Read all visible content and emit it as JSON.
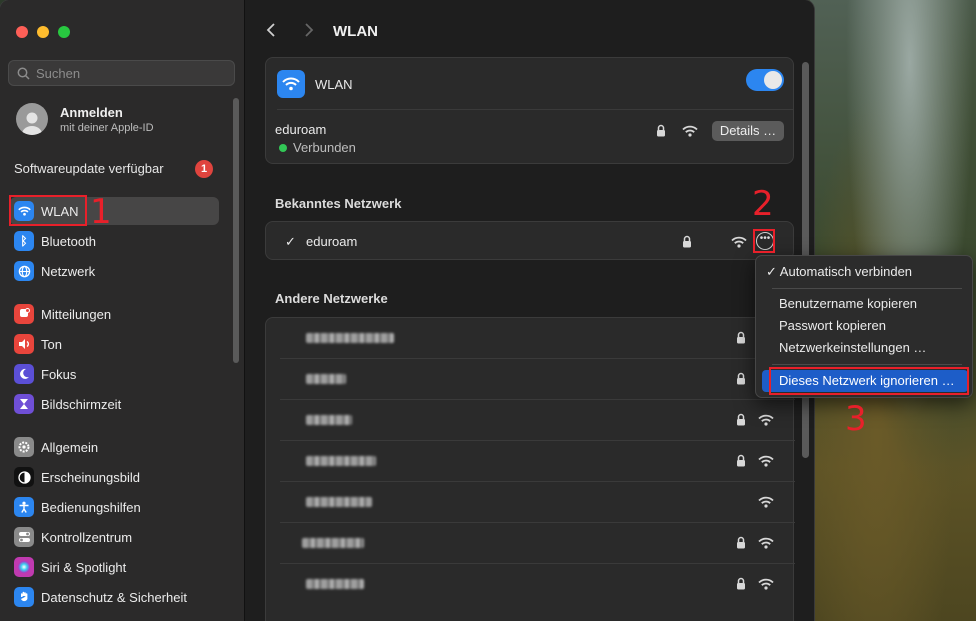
{
  "sidebar": {
    "search_placeholder": "Suchen",
    "account": {
      "title": "Anmelden",
      "subtitle": "mit deiner Apple-ID"
    },
    "update": {
      "label": "Softwareupdate verfügbar",
      "badge": "1"
    },
    "items": [
      {
        "label": "WLAN",
        "color": "#2c86f0",
        "glyph": "wifi"
      },
      {
        "label": "Bluetooth",
        "color": "#2c86f0",
        "glyph": "B"
      },
      {
        "label": "Netzwerk",
        "color": "#2c86f0",
        "glyph": "globe"
      },
      {
        "label": "Mitteilungen",
        "color": "#e8453c",
        "glyph": "bell"
      },
      {
        "label": "Ton",
        "color": "#e8453c",
        "glyph": "speaker"
      },
      {
        "label": "Fokus",
        "color": "#5b4fd6",
        "glyph": "moon"
      },
      {
        "label": "Bildschirmzeit",
        "color": "#6f4fd6",
        "glyph": "hourglass"
      },
      {
        "label": "Allgemein",
        "color": "#8a8a8a",
        "glyph": "gear"
      },
      {
        "label": "Erscheinungsbild",
        "color": "#111111",
        "glyph": "circle"
      },
      {
        "label": "Bedienungshilfen",
        "color": "#2c86f0",
        "glyph": "person"
      },
      {
        "label": "Kontrollzentrum",
        "color": "#8a8a8a",
        "glyph": "switches"
      },
      {
        "label": "Siri & Spotlight",
        "color": "#c03ab0",
        "glyph": "siri"
      },
      {
        "label": "Datenschutz & Sicherheit",
        "color": "#2c86f0",
        "glyph": "hand"
      }
    ]
  },
  "annotations": {
    "n1": "1",
    "n2": "2",
    "n3": "3"
  },
  "header": {
    "title": "WLAN"
  },
  "wlan_card": {
    "label": "WLAN",
    "connected_network": "eduroam",
    "status": "Verbunden",
    "details_button": "Details …"
  },
  "known": {
    "heading": "Bekanntes Netzwerk",
    "network": "eduroam",
    "checkmark": "✓"
  },
  "other": {
    "heading": "Andere Netzwerke",
    "rows": [
      {
        "lock": true,
        "wifi": true
      },
      {
        "lock": true,
        "wifi": true
      },
      {
        "lock": true,
        "wifi": true
      },
      {
        "lock": true,
        "wifi": true
      },
      {
        "lock": false,
        "wifi": true
      },
      {
        "lock": true,
        "wifi": true
      },
      {
        "lock": true,
        "wifi": true
      }
    ]
  },
  "context_menu": {
    "auto_join": "✓ Automatisch verbinden",
    "copy_username": "Benutzername kopieren",
    "copy_password": "Passwort kopieren",
    "network_settings": "Netzwerkeinstellungen …",
    "forget_network": "Dieses Netzwerk ignorieren …"
  }
}
